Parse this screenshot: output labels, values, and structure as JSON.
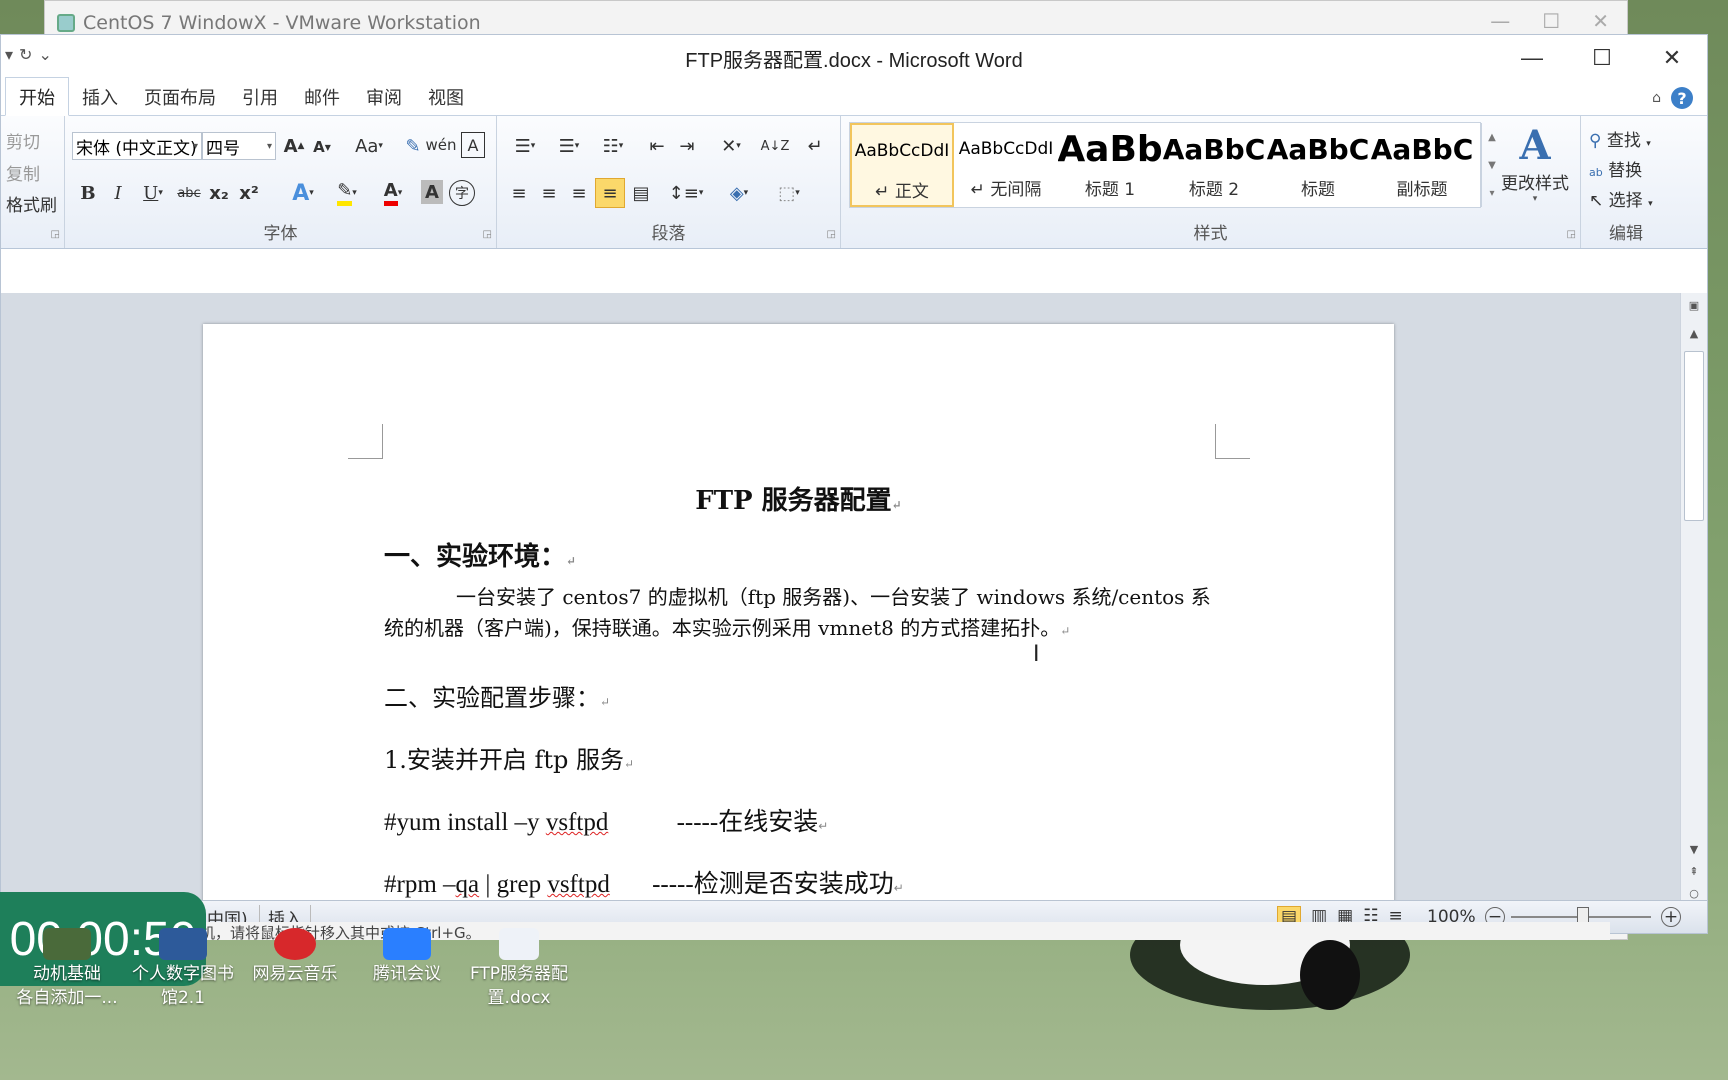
{
  "vmware": {
    "title": "CentOS 7 WindowX - VMware Workstation",
    "status_hint": "机，请将鼠标指针移入其中或按 Ctrl+G。"
  },
  "word": {
    "title": "FTP服务器配置.docx - Microsoft Word",
    "tabs": [
      "开始",
      "插入",
      "页面布局",
      "引用",
      "邮件",
      "审阅",
      "视图"
    ],
    "clipboard": {
      "cut": "剪切",
      "copy": "复制",
      "format_painter": "格式刷"
    },
    "font": {
      "name": "宋体 (中文正文)",
      "size": "四号",
      "group_label": "字体",
      "bold": "B",
      "italic": "I",
      "underline": "U",
      "strike": "abc",
      "subscript": "x₂",
      "superscript": "x²",
      "grow": "A",
      "shrink": "A",
      "case": "Aa"
    },
    "paragraph": {
      "group_label": "段落"
    },
    "styles": {
      "group_label": "样式",
      "items": [
        {
          "sample": "AaBbCcDdI",
          "name": "↵ 正文"
        },
        {
          "sample": "AaBbCcDdI",
          "name": "↵ 无间隔"
        },
        {
          "sample": "AaBb",
          "name": "标题 1"
        },
        {
          "sample": "AaBbC",
          "name": "标题 2"
        },
        {
          "sample": "AaBbC",
          "name": "标题"
        },
        {
          "sample": "AaBbC",
          "name": "副标题"
        }
      ],
      "change_styles": "更改样式"
    },
    "editing": {
      "group_label": "编辑",
      "find": "查找",
      "replace": "替换",
      "select": "选择"
    },
    "document": {
      "title": "FTP 服务器配置",
      "section1": "一、实验环境：",
      "para1": "一台安装了 centos7 的虚拟机（ftp 服务器)、一台安装了 windows 系统/centos 系统的机器（客户端)，保持联通。本实验示例采用 vmnet8 的方式搭建拓扑。",
      "section2": "二、实验配置步骤：",
      "step1": "1.安装并开启 ftp 服务",
      "cmd1": "#yum install –y vsftpd",
      "cmd1_note": "-----在线安装",
      "cmd2": "#rpm –qa | grep vsftpd",
      "cmd2_note": "-----检测是否安装成功"
    },
    "status": {
      "language": "中国)",
      "mode": "插入",
      "zoom": "100%"
    }
  },
  "timer": "00:00:50",
  "desktop_icons": [
    {
      "label": "动机基础\n各自添加一..."
    },
    {
      "label": "个人数字图书\n馆2.1"
    },
    {
      "label": "网易云音乐"
    },
    {
      "label": "腾讯会议"
    },
    {
      "label": "FTP服务器配\n置.docx"
    }
  ]
}
